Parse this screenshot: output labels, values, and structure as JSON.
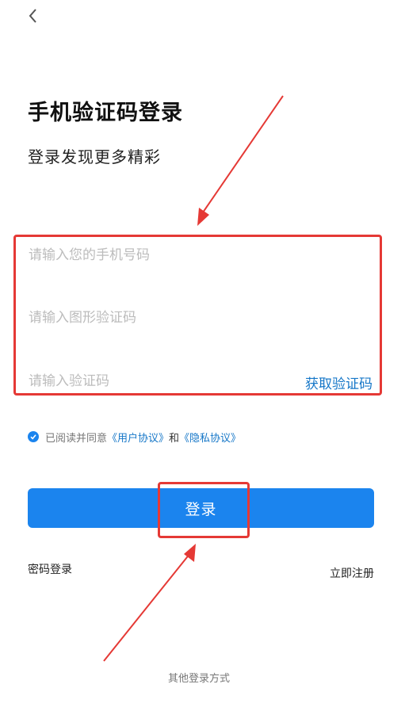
{
  "header": {
    "back_icon": "chevron-left-icon"
  },
  "title": "手机验证码登录",
  "subtitle": "登录发现更多精彩",
  "form": {
    "phone_placeholder": "请输入您的手机号码",
    "captcha_placeholder": "请输入图形验证码",
    "sms_placeholder": "请输入验证码",
    "get_code_label": "获取验证码"
  },
  "agreement": {
    "checked": true,
    "prefix": "已阅读并同意",
    "user_agreement": "《用户协议》",
    "conjunction": "和",
    "privacy_policy": "《隐私协议》"
  },
  "login_button": "登录",
  "password_login": "密码登录",
  "register": "立即注册",
  "other_login": "其他登录方式",
  "colors": {
    "primary": "#1b84ee",
    "link": "#1677c8",
    "annotation": "#e53935",
    "placeholder": "#bcbcbc"
  }
}
